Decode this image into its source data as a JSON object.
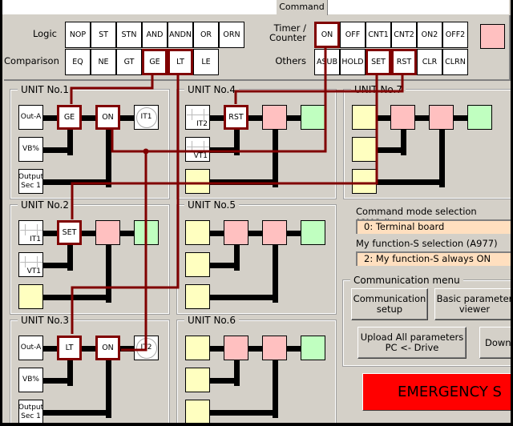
{
  "tab": "Command",
  "palette": {
    "rows": [
      {
        "label": "Logic",
        "buttons": [
          "NOP",
          "ST",
          "STN",
          "AND",
          "ANDN",
          "OR",
          "ORN"
        ],
        "selected": []
      },
      {
        "label": "Comparison",
        "buttons": [
          "EQ",
          "NE",
          "GT",
          "GE",
          "LT",
          "LE"
        ],
        "selected": [
          "GE",
          "LT"
        ]
      },
      {
        "label": "Timer / Counter",
        "buttons": [
          "ON",
          "OFF",
          "CNT1",
          "CNT2",
          "ON2",
          "OFF2"
        ],
        "selected": [
          "ON"
        ]
      },
      {
        "label": "Others",
        "buttons": [
          "ASUB",
          "HOLD",
          "SET",
          "RST",
          "CLR",
          "CLRN"
        ],
        "selected": [
          "SET",
          "RST"
        ]
      }
    ]
  },
  "colors": {
    "empty_slot": "#ffffc0",
    "function_slot": "#ffc0c0",
    "output_slot": "#c0ffc0",
    "link": "#800000",
    "emergency": "#ff0000",
    "field": "#ffdfbf"
  },
  "units": [
    {
      "title": "UNIT No.1",
      "cells": [
        [
          "Out-A",
          "n"
        ],
        [
          "GE",
          "s"
        ],
        [
          "ON",
          "s"
        ],
        [
          "IT1",
          "c"
        ],
        [
          "VB%",
          "n"
        ],
        [
          "Output Sec 1",
          "n"
        ]
      ]
    },
    {
      "title": "UNIT No.2",
      "cells": [
        [
          "IT1",
          "k"
        ],
        [
          "SET",
          "s"
        ],
        [
          "",
          "p"
        ],
        [
          "",
          "g"
        ],
        [
          "VT1",
          "k"
        ],
        [
          "",
          "y"
        ]
      ]
    },
    {
      "title": "UNIT No.3",
      "cells": [
        [
          "Out-A",
          "n"
        ],
        [
          "LT",
          "s"
        ],
        [
          "ON",
          "s"
        ],
        [
          "IT2",
          "c"
        ],
        [
          "VB%",
          "n"
        ],
        [
          "Output Sec 1",
          "n"
        ]
      ]
    },
    {
      "title": "UNIT No.4",
      "cells": [
        [
          "IT2",
          "k"
        ],
        [
          "RST",
          "s"
        ],
        [
          "",
          "p"
        ],
        [
          "",
          "g"
        ],
        [
          "VT1",
          "k"
        ],
        [
          "",
          "y"
        ]
      ]
    },
    {
      "title": "UNIT No.5",
      "cells": [
        [
          "",
          "y"
        ],
        [
          "",
          "p"
        ],
        [
          "",
          "p"
        ],
        [
          "",
          "g"
        ],
        [
          "",
          "y"
        ],
        [
          "",
          "y"
        ]
      ]
    },
    {
      "title": "UNIT No.6",
      "cells": [
        [
          "",
          "y"
        ],
        [
          "",
          "p"
        ],
        [
          "",
          "p"
        ],
        [
          "",
          "g"
        ],
        [
          "",
          "y"
        ],
        [
          "",
          "y"
        ]
      ]
    },
    {
      "title": "UNIT No.7",
      "cells": [
        [
          "",
          "y"
        ],
        [
          "",
          "p"
        ],
        [
          "",
          "p"
        ],
        [
          "",
          "g"
        ],
        [
          "",
          "y"
        ],
        [
          "",
          "y"
        ]
      ]
    }
  ],
  "settings": {
    "cmod_label": "Command mode selection (CMOd)",
    "cmod_value": "0: Terminal board",
    "a977_label": "My function-S selection (A977)",
    "a977_value": "2: My function-S always ON"
  },
  "comm": {
    "title": "Communication menu",
    "setup": "Communication setup",
    "viewer": "Basic parameter viewer",
    "upload": "Upload All parameters PC <- Drive",
    "download": "Downl"
  },
  "emergency": "EMERGENCY S"
}
